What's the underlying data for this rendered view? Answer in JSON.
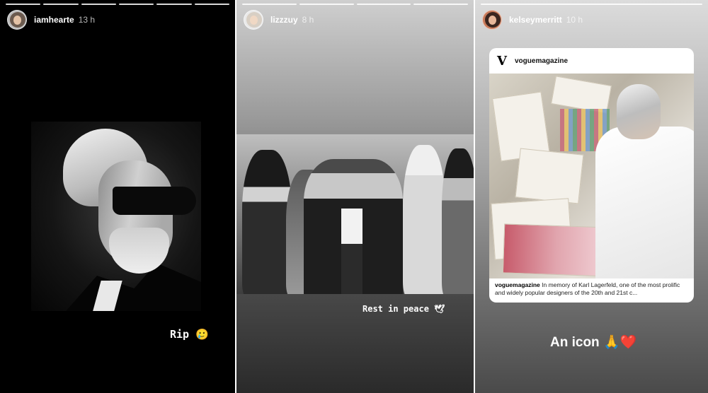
{
  "stories": [
    {
      "username": "iamhearte",
      "time": "13 h",
      "caption": "Rip 🥲"
    },
    {
      "username": "lizzzuy",
      "time": "8 h",
      "caption": "Rest in peace 🕊"
    },
    {
      "username": "kelseymerritt",
      "time": "10 h",
      "post": {
        "logo": "V",
        "author": "voguemagazine",
        "caption_author": "voguemagazine",
        "caption_text": " In memory of Karl Lagerfeld, one of the most prolific and widely popular designers of the 20th and 21st c..."
      },
      "caption": "An icon 🙏❤️"
    }
  ],
  "colors": {
    "background": "#000000",
    "text": "#ffffff",
    "card": "#ffffff"
  }
}
